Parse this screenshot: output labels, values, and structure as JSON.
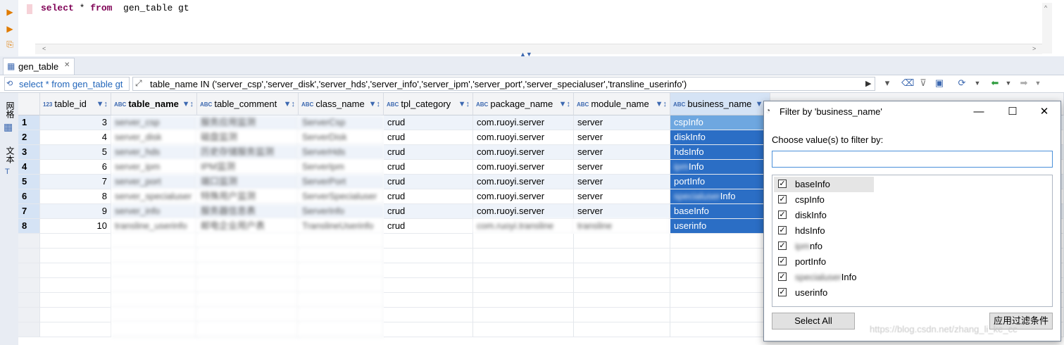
{
  "editor": {
    "sql_text": "select * from  gen_table gt",
    "sql_keyword1": "select",
    "sql_star": " * ",
    "sql_keyword2": "from",
    "sql_rest": "  gen_table gt"
  },
  "tab": {
    "label": "gen_table",
    "close": "✕"
  },
  "filterbar": {
    "query_label": "select * from gen_table gt",
    "filter_value": "table_name IN ('server_csp','server_disk','server_hds','server_info','server_ipm','server_port','server_specialuser','transline_userinfo')"
  },
  "sidetabs": {
    "grid": "网格",
    "text": "文本"
  },
  "columns": [
    {
      "type": "123",
      "name": "table_id",
      "bold": false
    },
    {
      "type": "ABC",
      "name": "table_name",
      "bold": true
    },
    {
      "type": "ABC",
      "name": "table_comment",
      "bold": false
    },
    {
      "type": "ABC",
      "name": "class_name",
      "bold": false
    },
    {
      "type": "ABC",
      "name": "tpl_category",
      "bold": false
    },
    {
      "type": "ABC",
      "name": "package_name",
      "bold": false
    },
    {
      "type": "ABC",
      "name": "module_name",
      "bold": false
    },
    {
      "type": "ABC",
      "name": "business_name",
      "bold": false
    }
  ],
  "rows": [
    {
      "n": "1",
      "id": "3",
      "table_name": "server_csp",
      "comment": "服务应用监测",
      "class_name": "ServerCsp",
      "tpl": "crud",
      "pkg": "com.ruoyi.server",
      "module": "server",
      "biz": "cspInfo"
    },
    {
      "n": "2",
      "id": "4",
      "table_name": "server_disk",
      "comment": "磁盘监测",
      "class_name": "ServerDisk",
      "tpl": "crud",
      "pkg": "com.ruoyi.server",
      "module": "server",
      "biz": "diskInfo"
    },
    {
      "n": "3",
      "id": "5",
      "table_name": "server_hds",
      "comment": "历史存储服务监测",
      "class_name": "ServerHds",
      "tpl": "crud",
      "pkg": "com.ruoyi.server",
      "module": "server",
      "biz": "hdsInfo"
    },
    {
      "n": "4",
      "id": "6",
      "table_name": "server_ipm",
      "comment": "IPM监测",
      "class_name": "ServerIpm",
      "tpl": "crud",
      "pkg": "com.ruoyi.server",
      "module": "server",
      "biz_blur": "ipm",
      "biz": "Info"
    },
    {
      "n": "5",
      "id": "7",
      "table_name": "server_port",
      "comment": "端口监测",
      "class_name": "ServerPort",
      "tpl": "crud",
      "pkg": "com.ruoyi.server",
      "module": "server",
      "biz": "portInfo"
    },
    {
      "n": "6",
      "id": "8",
      "table_name": "server_specialuser",
      "comment": "特殊用户监测",
      "class_name": "ServerSpecialuser",
      "tpl": "crud",
      "pkg": "com.ruoyi.server",
      "module": "server",
      "biz_blur": "specialuser",
      "biz": "Info"
    },
    {
      "n": "7",
      "id": "9",
      "table_name": "server_info",
      "comment": "服务器信息表",
      "class_name": "ServerInfo",
      "tpl": "crud",
      "pkg": "com.ruoyi.server",
      "module": "server",
      "biz": "baseInfo"
    },
    {
      "n": "8",
      "id": "10",
      "table_name": "transline_userinfo",
      "comment": "邮电企业用户表",
      "class_name": "TranslineUserinfo",
      "tpl": "crud",
      "pkg": "com.ruoyi.transline",
      "module": "transline",
      "biz": "userinfo"
    }
  ],
  "dialog": {
    "title": "Filter by 'business_name'",
    "label": "Choose value(s) to filter by:",
    "search_value": "",
    "items": [
      {
        "label": "baseInfo"
      },
      {
        "label": "cspInfo"
      },
      {
        "label": "diskInfo"
      },
      {
        "label": "hdsInfo"
      },
      {
        "blur": "ipm",
        "label": "nfo"
      },
      {
        "label": "portInfo"
      },
      {
        "blur": "specialuser",
        "label": "Info"
      },
      {
        "label": "userinfo"
      }
    ],
    "select_all": "Select All",
    "apply": "应用过滤条件",
    "minimize": "—",
    "maximize": "☐",
    "close": "✕"
  },
  "watermark": "https://blog.csdn.net/zhang_li_ke_cc",
  "colors": {
    "selection": "#2b6ec5",
    "header_bg": "#f3f4f6",
    "row_alt": "#eef3fa",
    "accent": "#3c68b0"
  }
}
